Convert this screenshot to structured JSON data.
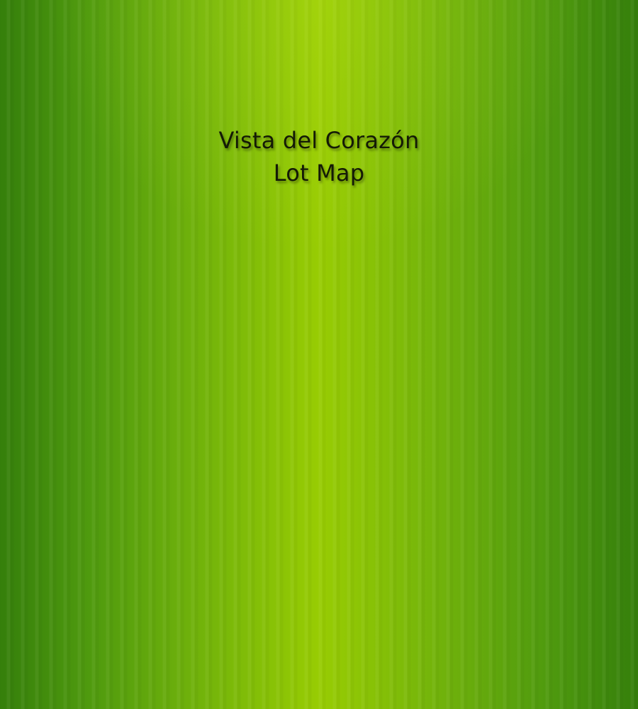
{
  "page": {
    "title_line_1": "Vista del Corazón",
    "title_line_2": "Lot Map",
    "colors": {
      "background_center": "#98cc03",
      "background_edge": "#357f0b",
      "title_text": "#141a06"
    }
  }
}
